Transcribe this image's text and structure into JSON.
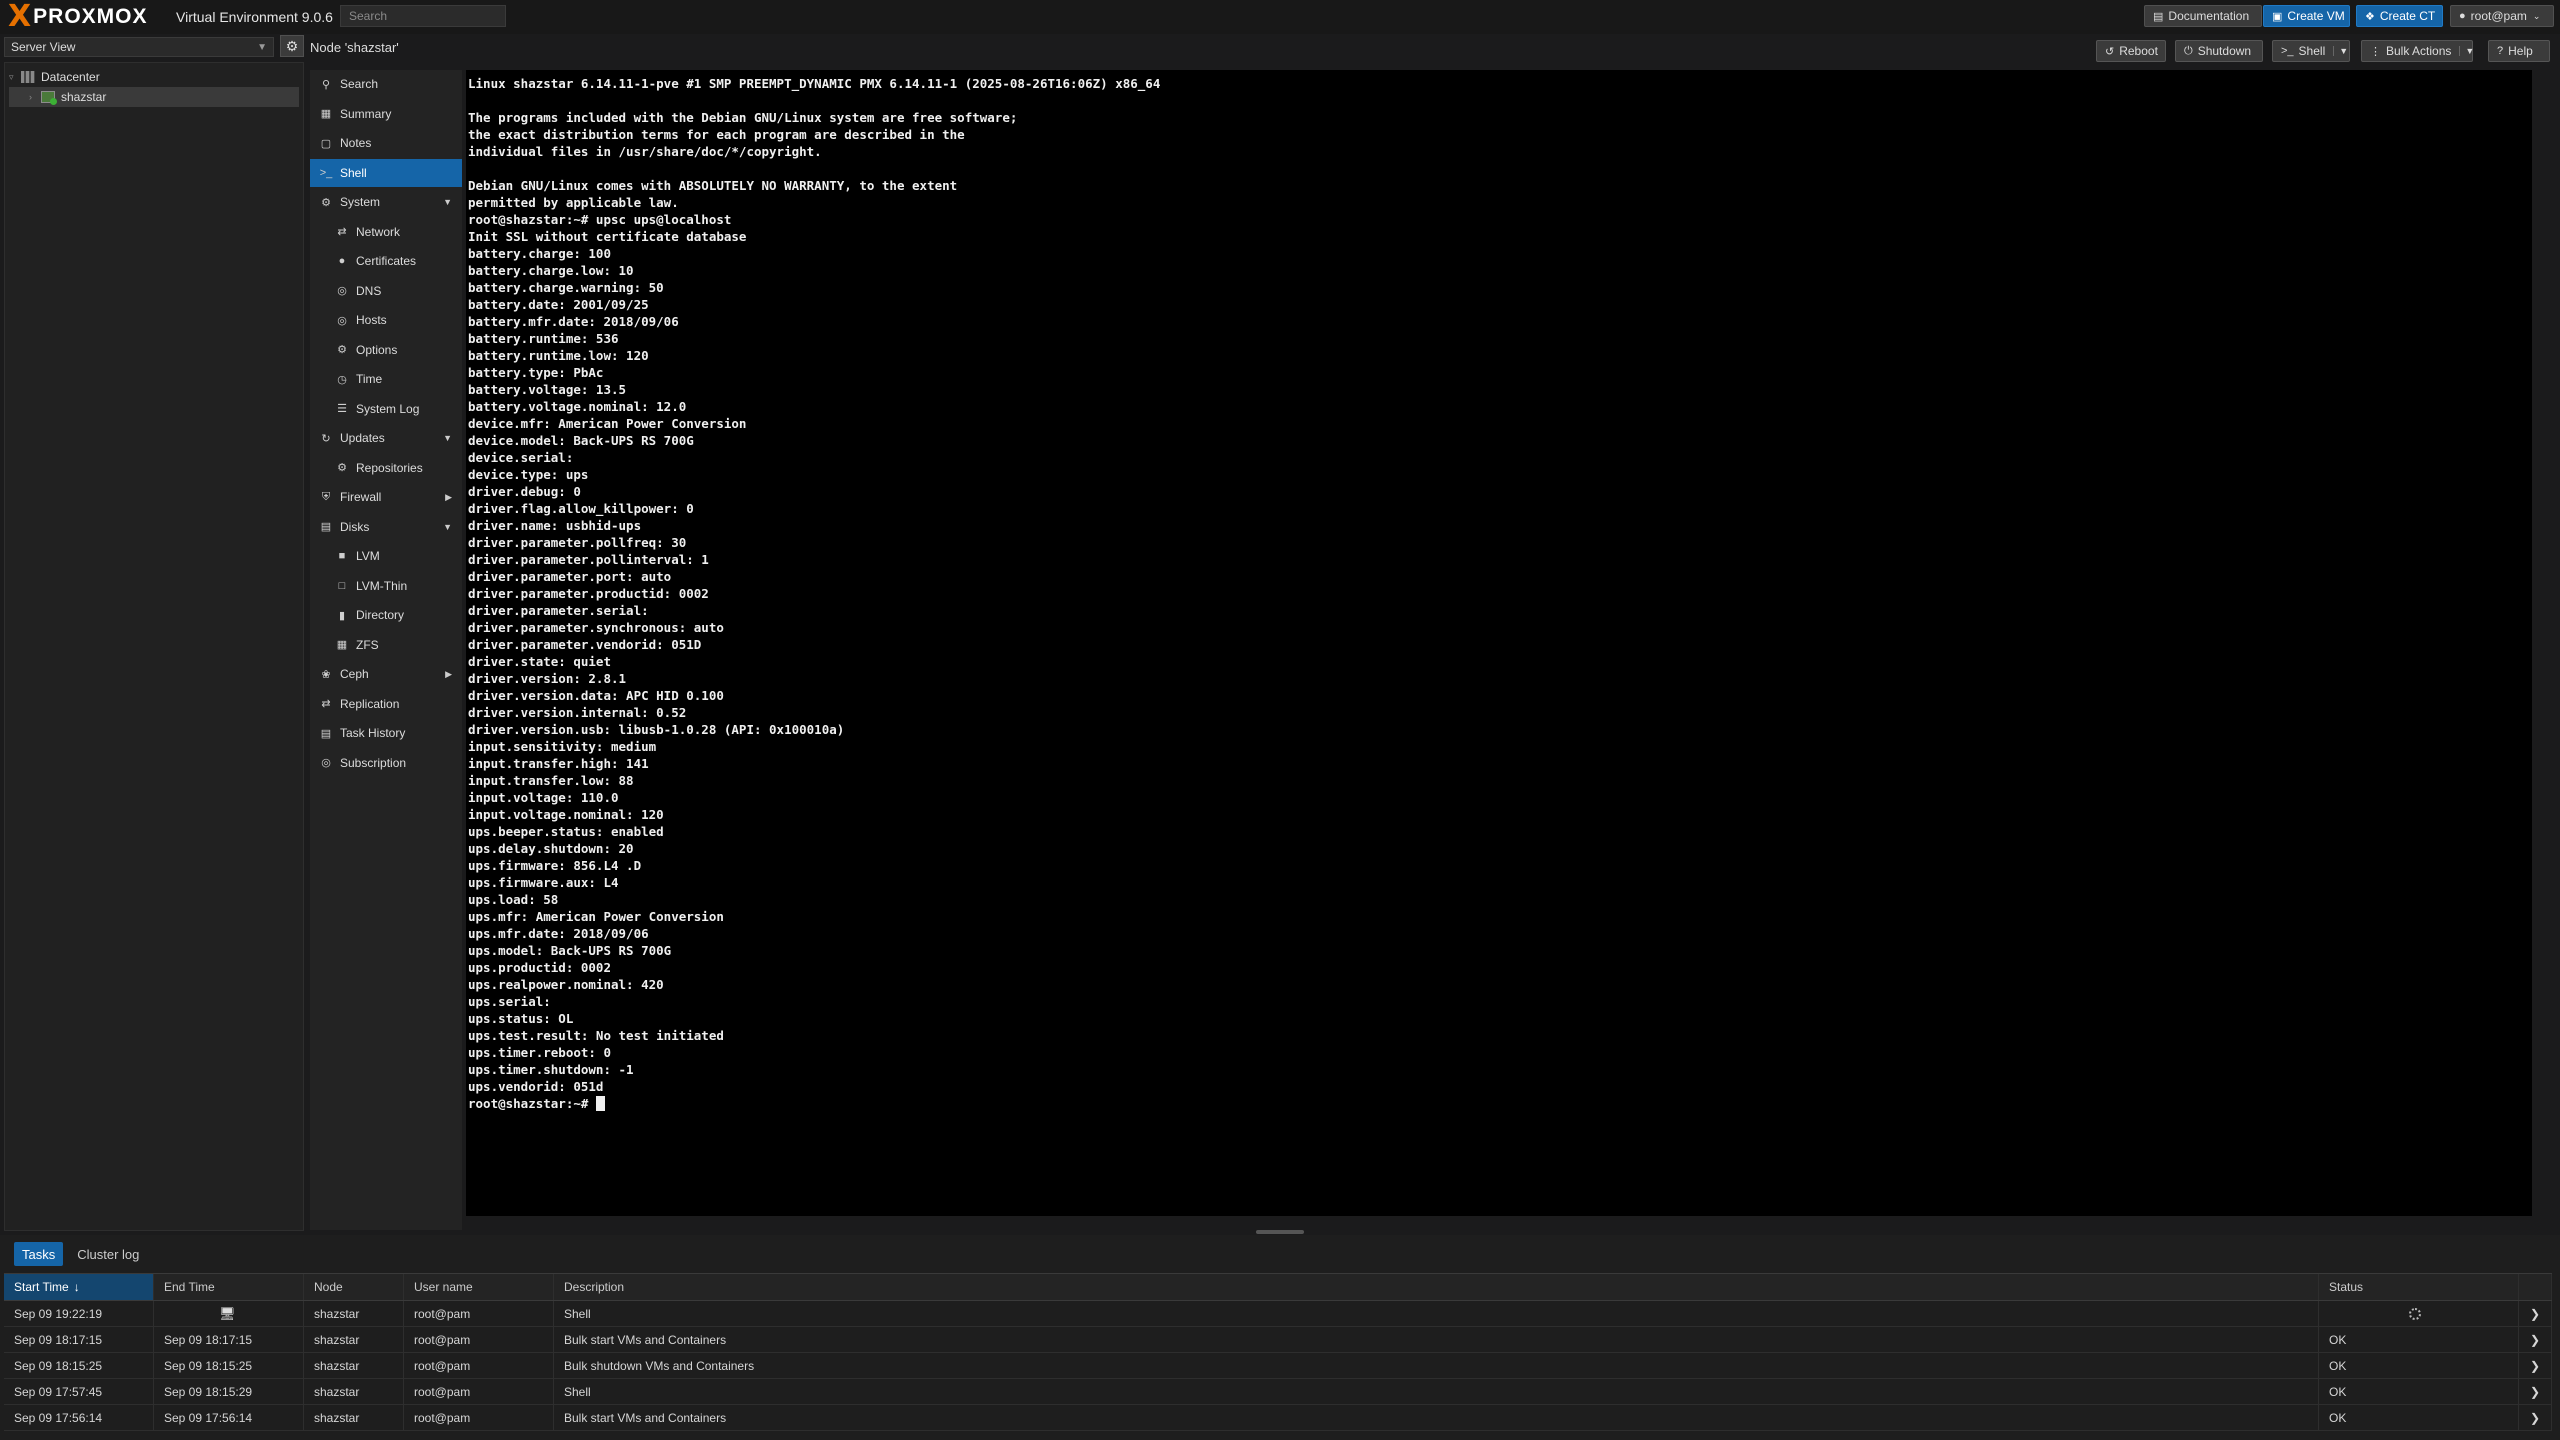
{
  "topbar": {
    "brand": "PROXMOX",
    "logo_x": "X",
    "version": "Virtual Environment 9.0.6",
    "search_placeholder": "Search",
    "documentation": "Documentation",
    "create_vm": "Create VM",
    "create_ct": "Create CT",
    "user": "root@pam"
  },
  "sidebar": {
    "view": "Server View",
    "tree": [
      {
        "label": "Datacenter",
        "icon": "datacenter-icon"
      },
      {
        "label": "shazstar",
        "icon": "node-icon"
      }
    ]
  },
  "node_header": {
    "title": "Node 'shazstar'",
    "reboot": "Reboot",
    "shutdown": "Shutdown",
    "shell": "Shell",
    "bulk_actions": "Bulk Actions",
    "help": "Help"
  },
  "menu": [
    {
      "label": "Search",
      "icon": "search-icon",
      "sub": false
    },
    {
      "label": "Summary",
      "icon": "summary-icon",
      "sub": false
    },
    {
      "label": "Notes",
      "icon": "notes-icon",
      "sub": false
    },
    {
      "label": "Shell",
      "icon": "terminal-icon",
      "sub": false,
      "active": true
    },
    {
      "label": "System",
      "icon": "gears-icon",
      "sub": false,
      "expander": "down"
    },
    {
      "label": "Network",
      "icon": "network-icon",
      "sub": true
    },
    {
      "label": "Certificates",
      "icon": "certificate-icon",
      "sub": true
    },
    {
      "label": "DNS",
      "icon": "globe-icon",
      "sub": true
    },
    {
      "label": "Hosts",
      "icon": "globe-icon",
      "sub": true
    },
    {
      "label": "Options",
      "icon": "gear-icon",
      "sub": true
    },
    {
      "label": "Time",
      "icon": "clock-icon",
      "sub": true
    },
    {
      "label": "System Log",
      "icon": "list-icon",
      "sub": true
    },
    {
      "label": "Updates",
      "icon": "refresh-icon",
      "sub": false,
      "expander": "down"
    },
    {
      "label": "Repositories",
      "icon": "repo-icon",
      "sub": true
    },
    {
      "label": "Firewall",
      "icon": "shield-icon",
      "sub": false,
      "expander": "right"
    },
    {
      "label": "Disks",
      "icon": "hdd-icon",
      "sub": false,
      "expander": "down"
    },
    {
      "label": "LVM",
      "icon": "square-icon",
      "sub": true
    },
    {
      "label": "LVM-Thin",
      "icon": "square-outline-icon",
      "sub": true
    },
    {
      "label": "Directory",
      "icon": "folder-icon",
      "sub": true
    },
    {
      "label": "ZFS",
      "icon": "grid-icon",
      "sub": true
    },
    {
      "label": "Ceph",
      "icon": "ceph-icon",
      "sub": false,
      "expander": "right"
    },
    {
      "label": "Replication",
      "icon": "retweet-icon",
      "sub": false
    },
    {
      "label": "Task History",
      "icon": "list-alt-icon",
      "sub": false
    },
    {
      "label": "Subscription",
      "icon": "support-icon",
      "sub": false
    }
  ],
  "terminal": {
    "lines": [
      "Linux shazstar 6.14.11-1-pve #1 SMP PREEMPT_DYNAMIC PMX 6.14.11-1 (2025-08-26T16:06Z) x86_64",
      "",
      "The programs included with the Debian GNU/Linux system are free software;",
      "the exact distribution terms for each program are described in the",
      "individual files in /usr/share/doc/*/copyright.",
      "",
      "Debian GNU/Linux comes with ABSOLUTELY NO WARRANTY, to the extent",
      "permitted by applicable law.",
      "root@shazstar:~# upsc ups@localhost",
      "Init SSL without certificate database",
      "battery.charge: 100",
      "battery.charge.low: 10",
      "battery.charge.warning: 50",
      "battery.date: 2001/09/25",
      "battery.mfr.date: 2018/09/06",
      "battery.runtime: 536",
      "battery.runtime.low: 120",
      "battery.type: PbAc",
      "battery.voltage: 13.5",
      "battery.voltage.nominal: 12.0",
      "device.mfr: American Power Conversion",
      "device.model: Back-UPS RS 700G",
      "device.serial:",
      "device.type: ups",
      "driver.debug: 0",
      "driver.flag.allow_killpower: 0",
      "driver.name: usbhid-ups",
      "driver.parameter.pollfreq: 30",
      "driver.parameter.pollinterval: 1",
      "driver.parameter.port: auto",
      "driver.parameter.productid: 0002",
      "driver.parameter.serial:",
      "driver.parameter.synchronous: auto",
      "driver.parameter.vendorid: 051D",
      "driver.state: quiet",
      "driver.version: 2.8.1",
      "driver.version.data: APC HID 0.100",
      "driver.version.internal: 0.52",
      "driver.version.usb: libusb-1.0.28 (API: 0x100010a)",
      "input.sensitivity: medium",
      "input.transfer.high: 141",
      "input.transfer.low: 88",
      "input.voltage: 110.0",
      "input.voltage.nominal: 120",
      "ups.beeper.status: enabled",
      "ups.delay.shutdown: 20",
      "ups.firmware: 856.L4 .D",
      "ups.firmware.aux: L4",
      "ups.load: 58",
      "ups.mfr: American Power Conversion",
      "ups.mfr.date: 2018/09/06",
      "ups.model: Back-UPS RS 700G",
      "ups.productid: 0002",
      "ups.realpower.nominal: 420",
      "ups.serial:",
      "ups.status: OL",
      "ups.test.result: No test initiated",
      "ups.timer.reboot: 0",
      "ups.timer.shutdown: -1",
      "ups.vendorid: 051d"
    ],
    "prompt": "root@shazstar:~# "
  },
  "bottom": {
    "tabs": [
      "Tasks",
      "Cluster log"
    ],
    "columns": [
      "Start Time",
      "End Time",
      "Node",
      "User name",
      "Description",
      "Status"
    ],
    "rows": [
      {
        "start": "Sep 09 19:22:19",
        "end": "",
        "node": "shazstar",
        "user": "root@pam",
        "desc": "Shell",
        "status": ""
      },
      {
        "start": "Sep 09 18:17:15",
        "end": "Sep 09 18:17:15",
        "node": "shazstar",
        "user": "root@pam",
        "desc": "Bulk start VMs and Containers",
        "status": "OK"
      },
      {
        "start": "Sep 09 18:15:25",
        "end": "Sep 09 18:15:25",
        "node": "shazstar",
        "user": "root@pam",
        "desc": "Bulk shutdown VMs and Containers",
        "status": "OK"
      },
      {
        "start": "Sep 09 17:57:45",
        "end": "Sep 09 18:15:29",
        "node": "shazstar",
        "user": "root@pam",
        "desc": "Shell",
        "status": "OK"
      },
      {
        "start": "Sep 09 17:56:14",
        "end": "Sep 09 17:56:14",
        "node": "shazstar",
        "user": "root@pam",
        "desc": "Bulk start VMs and Containers",
        "status": "OK"
      }
    ]
  },
  "colors": {
    "accent": "#1565a8",
    "logo_orange": "#e57000",
    "background": "#1b1b1c",
    "terminal_bg": "#000000"
  }
}
